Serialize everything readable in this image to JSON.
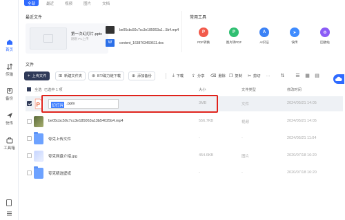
{
  "top_tabs": [
    "全部",
    "最近",
    "视频",
    "图片",
    "文档"
  ],
  "sidebar": [
    {
      "label": "首页",
      "icon": "home-icon",
      "active": true
    },
    {
      "label": "传输",
      "icon": "transfer-icon",
      "active": false
    },
    {
      "label": "备份",
      "icon": "backup-icon",
      "active": false
    },
    {
      "label": "快传",
      "icon": "quick-send-icon",
      "active": false
    },
    {
      "label": "工具箱",
      "icon": "toolbox-icon",
      "active": false
    }
  ],
  "recent": {
    "title": "最近文件",
    "big_card": {
      "name": "第一次幻灯片.pptx",
      "sub": "刚刚  PC上传"
    },
    "files": [
      {
        "name": "be05cbc50c7cc3e185063a1...5b4.mp4",
        "icon": "video-file-icon"
      },
      {
        "name": "content_1638763469611.doc",
        "icon": "word-file-icon"
      }
    ]
  },
  "tools": {
    "title": "常用工具",
    "items": [
      {
        "label": "PDF转换",
        "icon": "pdf-convert-icon",
        "color": "#f25a4b",
        "glyph": "P"
      },
      {
        "label": "图片转PDF",
        "icon": "image-to-pdf-icon",
        "color": "#2fbf71",
        "glyph": "P"
      },
      {
        "label": "AI识证",
        "icon": "ai-recognize-icon",
        "color": "#3b82f6",
        "glyph": "A"
      },
      {
        "label": "快传",
        "icon": "quick-send-icon",
        "color": "#3f8cff",
        "glyph": "➤"
      },
      {
        "label": "回收站",
        "icon": "trash-icon",
        "color": "#8b5cf6",
        "glyph": "♻"
      }
    ]
  },
  "files": {
    "title": "文件",
    "toolbar": {
      "upload": "上传文件",
      "new_folder": "新建文件夹",
      "bt_download": "BT/磁力链下载",
      "add_backup": "添加备份",
      "download": "下载",
      "share": "分享",
      "delete": "删除",
      "copy": "复制",
      "cut": "剪切",
      "more": "···"
    },
    "header": {
      "select_all": "全选",
      "selected": "已选中 1 项",
      "size": "大小",
      "type": "文件类型",
      "modified": "修改时间"
    },
    "rename_selected": "幻灯片",
    "rename_rest": ".pptx",
    "rows": [
      {
        "name": "",
        "size": "3MB",
        "type": "文件",
        "time": "2024/05/21 14:05",
        "icon": "ppt-file-icon",
        "checked": true
      },
      {
        "name": "be05cbc50c7cc3e185063a13b54025b4.mp4",
        "size": "556.7KB",
        "type": "视频",
        "time": "2024/05/21 14:05",
        "icon": "video-thumb-icon",
        "checked": false
      },
      {
        "name": "夸克上传文件",
        "size": "-",
        "type": "-",
        "time": "2024/05/21 11:04",
        "icon": "folder-icon",
        "checked": false
      },
      {
        "name": "夸克网盘介绍.jpg",
        "size": "454.6KB",
        "type": "图片",
        "time": "2020/07/18 16:20",
        "icon": "image-file-icon",
        "checked": false
      },
      {
        "name": "夸克精选壁纸",
        "size": "-",
        "type": "-",
        "time": "2020/07/18 16:20",
        "icon": "folder-icon",
        "checked": false
      }
    ]
  }
}
